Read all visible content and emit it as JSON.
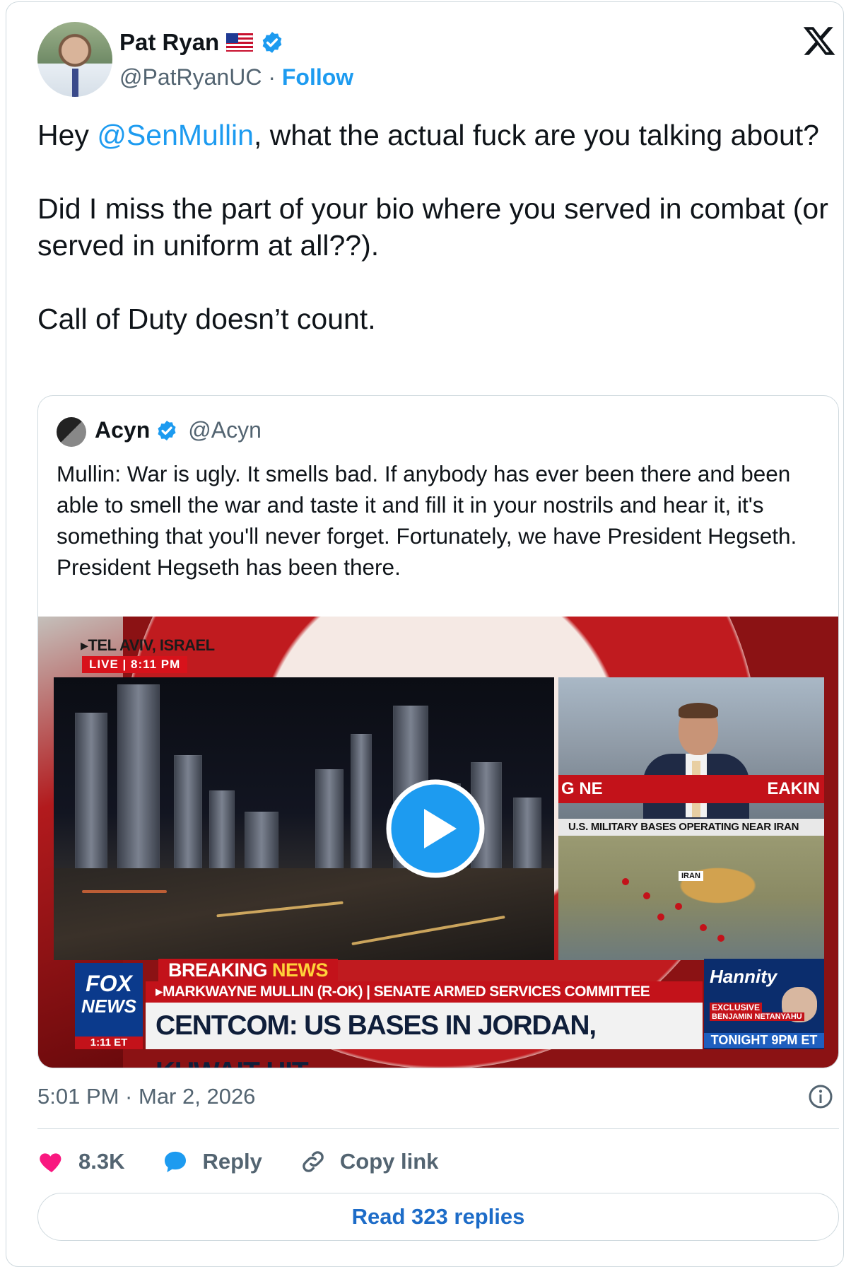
{
  "author": {
    "name": "Pat Ryan",
    "handle": "@PatRyanUC",
    "separator": "·",
    "follow_label": "Follow"
  },
  "tweet": {
    "line1_prefix": "Hey ",
    "line1_mention": "@SenMullin",
    "line1_rest": ", what the actual fuck are you talking about?",
    "para2": "Did I miss the part of your bio where you served in combat (or served in uniform at all??).",
    "para3": "Call of Duty doesn’t count."
  },
  "quote": {
    "name": "Acyn",
    "handle": "@Acyn",
    "text": "Mullin: War is ugly. It smells bad. If anybody has ever been there and been able to smell the war and taste it and fill it in your nostrils and hear it, it's something that you'll never forget. Fortunately, we have President Hegseth. President Hegseth has been there.",
    "video": {
      "location": "▸TEL AVIV, ISRAEL",
      "live": "LIVE",
      "live_time": "8:11 PM",
      "studio_ticker_left": "G NE",
      "studio_ticker_right": "EAKIN",
      "map_title": "U.S. MILITARY BASES OPERATING NEAR IRAN",
      "map_label": "IRAN",
      "breaking_word": "BREAKING",
      "news_word": "NEWS",
      "subheadline": "▸MARKWAYNE MULLIN (R-OK) | SENATE ARMED SERVICES COMMITTEE",
      "headline": "CENTCOM: US BASES IN JORDAN, KUWAIT HIT",
      "network_line1": "FOX",
      "network_line2": "NEWS",
      "network_time": "1:11 ET",
      "promo_show": "Hannity",
      "promo_exclusive": "EXCLUSIVE",
      "promo_guest": "BENJAMIN NETANYAHU",
      "promo_when": "TONIGHT 9PM ET"
    }
  },
  "meta": {
    "timestamp": "5:01 PM · Mar 2, 2026"
  },
  "actions": {
    "likes": "8.3K",
    "reply_label": "Reply",
    "copy_label": "Copy link"
  },
  "read_replies_label": "Read 323 replies",
  "colors": {
    "accent": "#1d9bf0",
    "like": "#f91880",
    "muted": "#536471",
    "border": "#cfd9de",
    "fox_red": "#c3121a"
  },
  "icons": [
    "us-flag-icon",
    "verified-badge-icon",
    "x-logo-icon",
    "play-icon",
    "info-icon",
    "heart-icon",
    "reply-bubble-icon",
    "link-icon"
  ]
}
